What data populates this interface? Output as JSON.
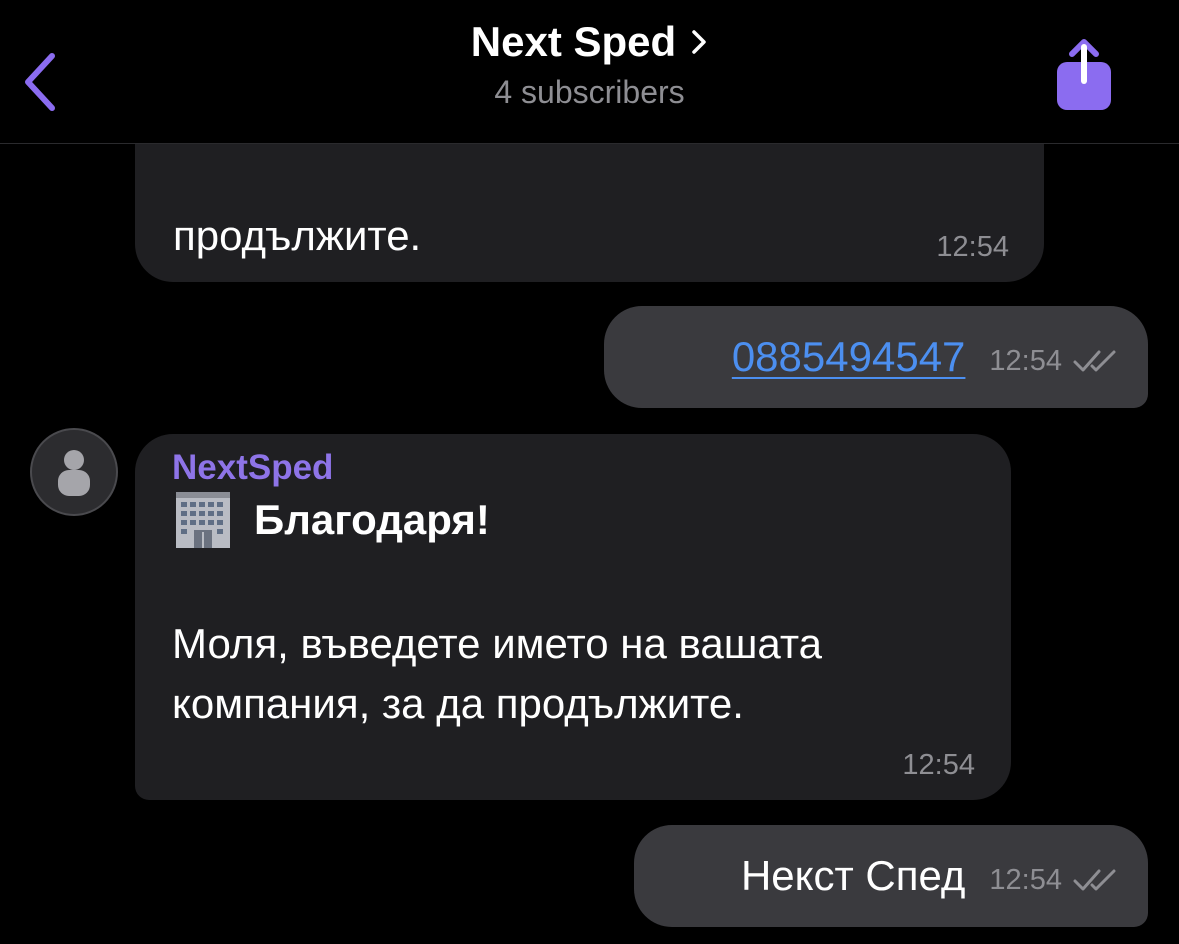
{
  "header": {
    "back_icon": "chevron-left-icon",
    "title": "Next Sped",
    "title_chevron_icon": "chevron-right-icon",
    "subtitle": "4 subscribers",
    "share_icon": "share-icon",
    "accent_color": "#8b6cf0"
  },
  "messages": [
    {
      "direction": "incoming",
      "partial_text": "продължите.",
      "time": "12:54"
    },
    {
      "direction": "outgoing",
      "text": "0885494547",
      "is_link": true,
      "time": "12:54",
      "status_icon": "double-check-icon"
    },
    {
      "direction": "incoming",
      "sender": "NextSped",
      "avatar_icon": "user-avatar-icon",
      "emoji": "office-building-icon",
      "headline": "Благодаря!",
      "body": "Моля, въведете името на вашата компания, за да продължите.",
      "time": "12:54"
    },
    {
      "direction": "outgoing",
      "text": "Некст Спед",
      "time": "12:54",
      "status_icon": "double-check-icon"
    }
  ],
  "colors": {
    "background": "#000000",
    "incoming_bubble": "#1f1f22",
    "outgoing_bubble": "#3a3a3e",
    "link": "#4c8ff0",
    "sender_name": "#8e74e8",
    "timestamp": "#8e8e93"
  }
}
